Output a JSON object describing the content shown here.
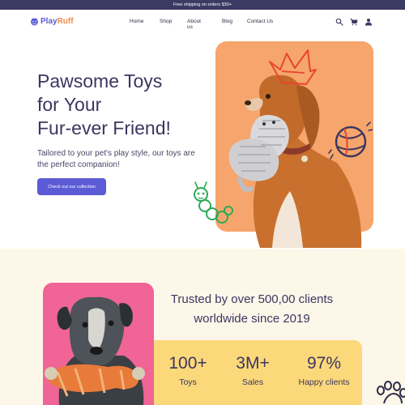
{
  "topbar": {
    "text": "Free shipping on orders $30+"
  },
  "brand": {
    "part1": "Play",
    "part2": "Ruff"
  },
  "nav": {
    "items": [
      "Home",
      "Shop",
      "About us",
      "Blog",
      "Contact Us"
    ]
  },
  "hero": {
    "title_line1": "Pawsome Toys",
    "title_line2": "for Your",
    "title_line3": "Fur-ever Friend!",
    "subtitle": "Tailored to your pet's play style, our toys are the perfect companion!",
    "cta": "Check out our collection"
  },
  "trust": {
    "line1": "Trusted by over 500,00 clients",
    "line2": "worldwide since 2019"
  },
  "stats": [
    {
      "value": "100+",
      "label": "Toys"
    },
    {
      "value": "3M+",
      "label": "Sales"
    },
    {
      "value": "97%",
      "label": "Happy clients"
    }
  ],
  "colors": {
    "primary": "#5b5bd6",
    "accent_orange": "#f6a56c",
    "accent_pink": "#f06595",
    "accent_yellow": "#fbd87a",
    "cream": "#fdf7e9",
    "dark": "#3b3a63"
  },
  "icons": [
    "paw-logo-icon",
    "search-icon",
    "cart-icon",
    "user-icon",
    "paw-print-icon"
  ]
}
